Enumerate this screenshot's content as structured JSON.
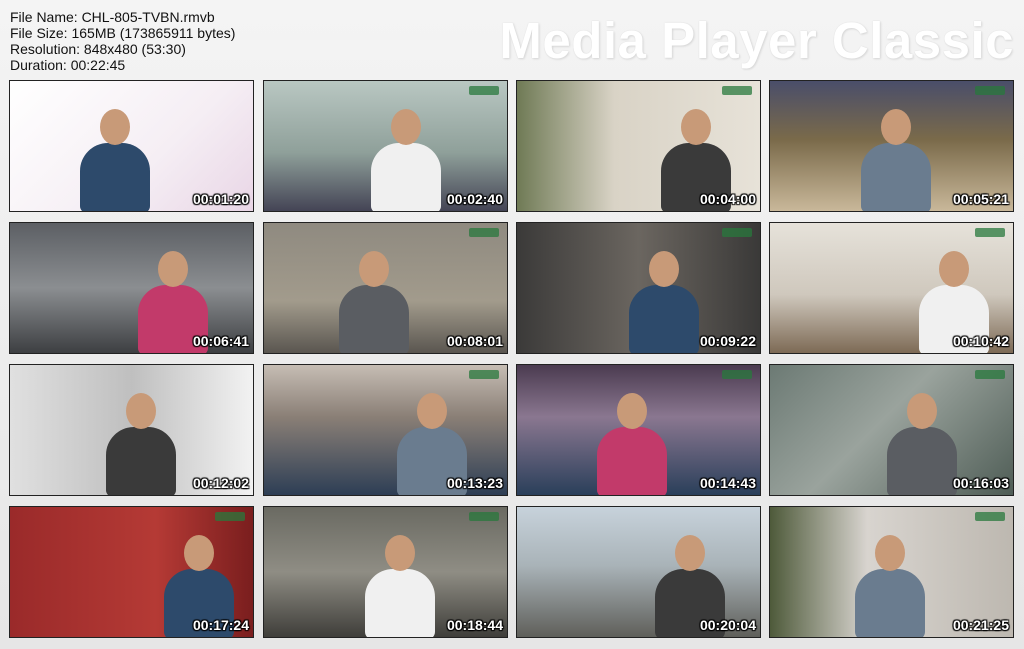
{
  "info": {
    "file_name": "File Name: CHL-805-TVBN.rmvb",
    "file_size": "File Size: 165MB (173865911 bytes)",
    "resolution": "Resolution: 848x480 (53:30)",
    "duration": "Duration: 00:22:45"
  },
  "brand": "Media Player Classic",
  "thumbnails": [
    {
      "time": "00:01:20",
      "bg": "linear-gradient(135deg,#ffffff 0%,#f5eef4 60%,#e9d6e6 100%)",
      "logo": false
    },
    {
      "time": "00:02:40",
      "bg": "linear-gradient(180deg,#b9c7c2 0%,#8fa09a 55%,#445 100%)",
      "logo": true
    },
    {
      "time": "00:04:00",
      "bg": "linear-gradient(90deg,#6f7a55 0%,#d9d3c6 40%,#e7e2d8 100%)",
      "logo": true
    },
    {
      "time": "00:05:21",
      "bg": "linear-gradient(180deg,#4a4e6a 0%,#7a6a4a 45%,#c9b89a 100%)",
      "logo": true
    },
    {
      "time": "00:06:41",
      "bg": "linear-gradient(180deg,#5c5f64 0%,#8b8e91 50%,#3d3f42 100%)",
      "logo": false
    },
    {
      "time": "00:08:01",
      "bg": "linear-gradient(180deg,#8f8a80 0%,#a29b8c 60%,#5a5650 100%)",
      "logo": true
    },
    {
      "time": "00:09:22",
      "bg": "linear-gradient(90deg,#3b3a39 0%,#6b6660 50%,#3a3938 100%)",
      "logo": true
    },
    {
      "time": "00:10:42",
      "bg": "linear-gradient(180deg,#e6e2da 0%,#cfc8bd 55%,#7d6a55 100%)",
      "logo": true
    },
    {
      "time": "00:12:02",
      "bg": "linear-gradient(90deg,#e0e0e0 0%,#bfbfbf 50%,#f2f2f2 100%)",
      "logo": false
    },
    {
      "time": "00:13:23",
      "bg": "linear-gradient(180deg,#c6bdb4 0%,#8a7f76 40%,#2d3e55 100%)",
      "logo": true
    },
    {
      "time": "00:14:43",
      "bg": "linear-gradient(180deg,#4b3b50 0%,#8a7790 40%,#2a3f5a 100%)",
      "logo": true
    },
    {
      "time": "00:16:03",
      "bg": "linear-gradient(135deg,#6c7a74 0%,#9aa39d 45%,#4f5d56 100%)",
      "logo": true
    },
    {
      "time": "00:17:24",
      "bg": "linear-gradient(90deg,#9a2a2a 0%,#b53a35 60%,#7a1e1e 100%)",
      "logo": true
    },
    {
      "time": "00:18:44",
      "bg": "linear-gradient(180deg,#6a6a62 0%,#8f8d84 50%,#3f3e3a 100%)",
      "logo": true
    },
    {
      "time": "00:20:04",
      "bg": "linear-gradient(180deg,#c7d2db 0%,#a9b3b8 45%,#5f5f5a 100%)",
      "logo": false
    },
    {
      "time": "00:21:25",
      "bg": "linear-gradient(90deg,#4e5a3a 0%,#d8d4cf 40%,#bdb8b0 100%)",
      "logo": true
    }
  ]
}
